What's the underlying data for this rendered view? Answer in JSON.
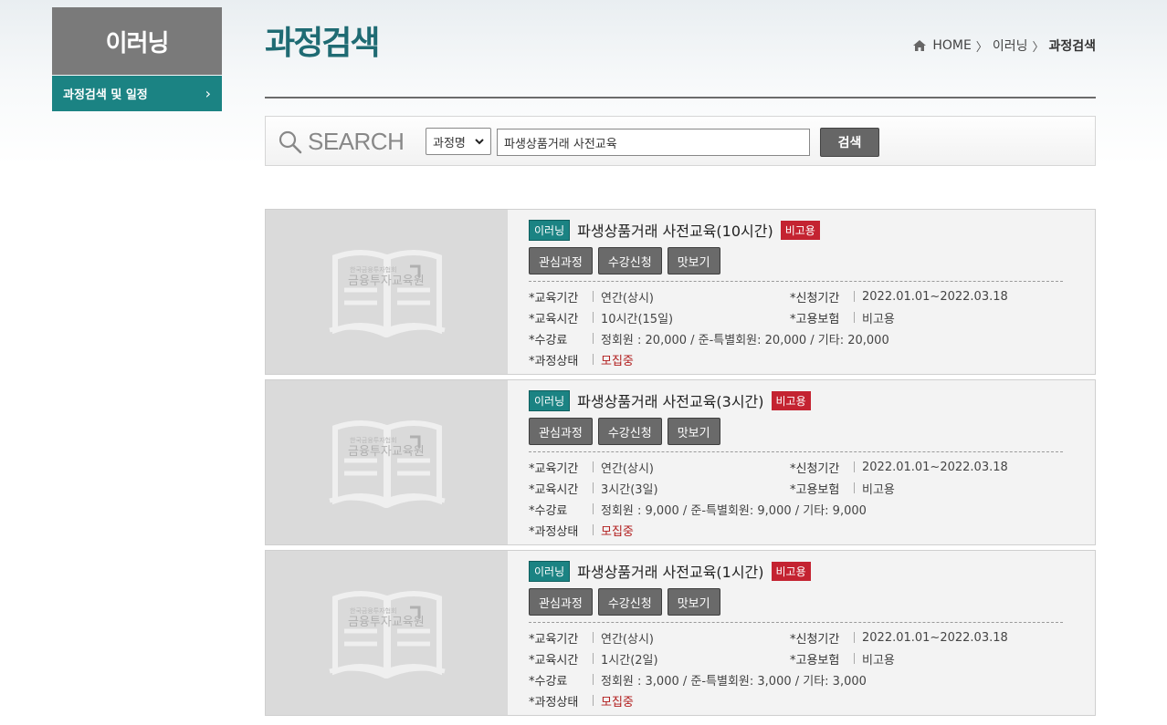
{
  "sidebar": {
    "title": "이러닝",
    "items": [
      {
        "label": "과정검색 및 일정",
        "chevron": "›"
      }
    ]
  },
  "header": {
    "title": "과정검색",
    "breadcrumb": {
      "home": "HOME",
      "level1": "이러닝",
      "current": "과정검색",
      "sep": "〉"
    }
  },
  "search": {
    "label": "SEARCH",
    "select_value": "과정명",
    "input_value": "파생상품거래 사전교육",
    "button_label": "검색"
  },
  "labels": {
    "period": "*교육기간",
    "time": "*교육시간",
    "fee": "*수강료",
    "status": "*과정상태",
    "apply": "*신청기간",
    "insurance": "*고용보험"
  },
  "buttons": {
    "interest": "관심과정",
    "apply": "수강신청",
    "preview": "맛보기"
  },
  "thumb_text": {
    "line1": "한국금융투자협회",
    "line2": "금융투자교육원"
  },
  "courses": [
    {
      "type": "이러닝",
      "title": "파생상품거래 사전교육(10시간)",
      "insurance_badge": "비고용",
      "period": "연간(상시)",
      "time": "10시간(15일)",
      "fee": "정회원 : 20,000 / 준-특별회원: 20,000 / 기타: 20,000",
      "status": "모집중",
      "apply_period": "2022.01.01~2022.03.18",
      "insurance": "비고용"
    },
    {
      "type": "이러닝",
      "title": "파생상품거래 사전교육(3시간)",
      "insurance_badge": "비고용",
      "period": "연간(상시)",
      "time": "3시간(3일)",
      "fee": "정회원 : 9,000 / 준-특별회원: 9,000 / 기타: 9,000",
      "status": "모집중",
      "apply_period": "2022.01.01~2022.03.18",
      "insurance": "비고용"
    },
    {
      "type": "이러닝",
      "title": "파생상품거래 사전교육(1시간)",
      "insurance_badge": "비고용",
      "period": "연간(상시)",
      "time": "1시간(2일)",
      "fee": "정회원 : 3,000 / 준-특별회원: 3,000 / 기타: 3,000",
      "status": "모집중",
      "apply_period": "2022.01.01~2022.03.18",
      "insurance": "비고용"
    }
  ],
  "colors": {
    "teal": "#1b8383",
    "title_teal": "#1f6b73",
    "red_badge": "#c42331",
    "status_red": "#b11d1d"
  }
}
